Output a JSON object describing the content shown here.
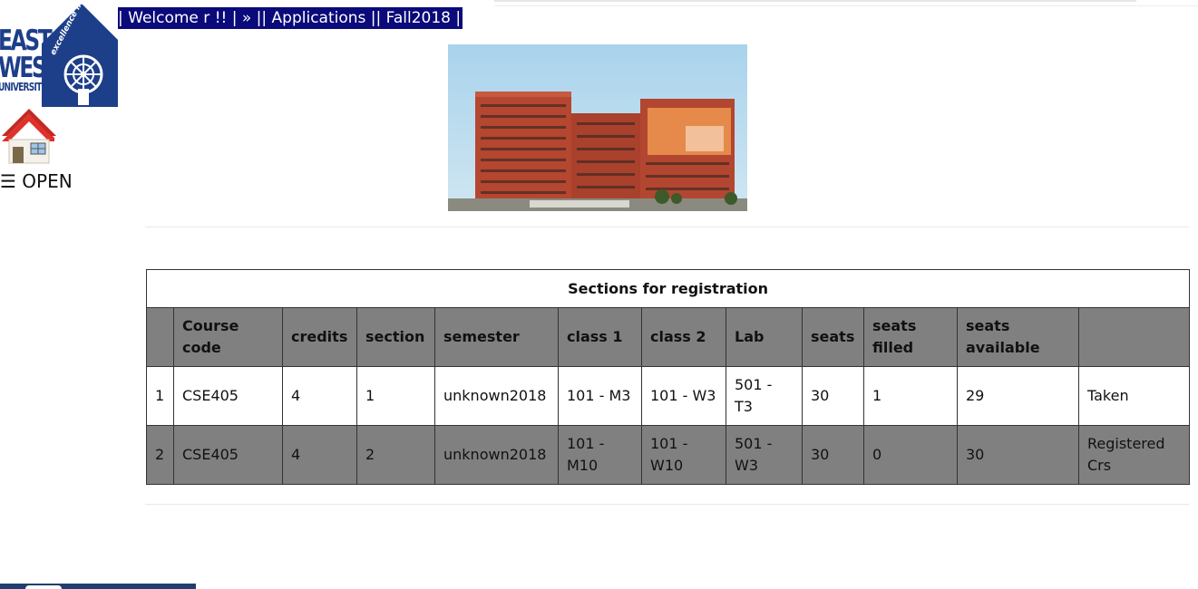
{
  "header": {
    "logo_text_line1": "EAST",
    "logo_text_line2": "WEST",
    "logo_text_line3": "UNIVERSITY",
    "logo_motto": "excellence in education",
    "welcome_bar": {
      "welcome": "| Welcome r !! | » ||",
      "applications": "Applications",
      "semester": "|| Fall2018 |"
    }
  },
  "nav": {
    "home_icon": "home-icon",
    "open_menu_glyph": "☰",
    "open_menu_label": "OPEN"
  },
  "table": {
    "title": "Sections for registration",
    "headers": [
      "",
      "Course code",
      "credits",
      "section",
      "semester",
      "class 1",
      "class 2",
      "Lab",
      "seats",
      "seats filled",
      "seats available",
      ""
    ],
    "rows": [
      {
        "num": "1",
        "course_code": "CSE405",
        "credits": "4",
        "section": "1",
        "semester": "unknown2018",
        "class1": "101 - M3",
        "class2": "101 - W3",
        "lab": "501 - T3",
        "seats": "30",
        "seats_filled": "1",
        "seats_available": "29",
        "status": "Taken"
      },
      {
        "num": "2",
        "course_code": "CSE405",
        "credits": "4",
        "section": "2",
        "semester": "unknown2018",
        "class1": "101 - M10",
        "class2": "101 - W10",
        "lab": "501 - W3",
        "seats": "30",
        "seats_filled": "0",
        "seats_available": "30",
        "status": "Registered Crs"
      }
    ]
  },
  "colors": {
    "welcome_bar_bg": "#0a0a7a",
    "table_header_bg": "#808080",
    "logo_blue": "#1d3f8a"
  }
}
